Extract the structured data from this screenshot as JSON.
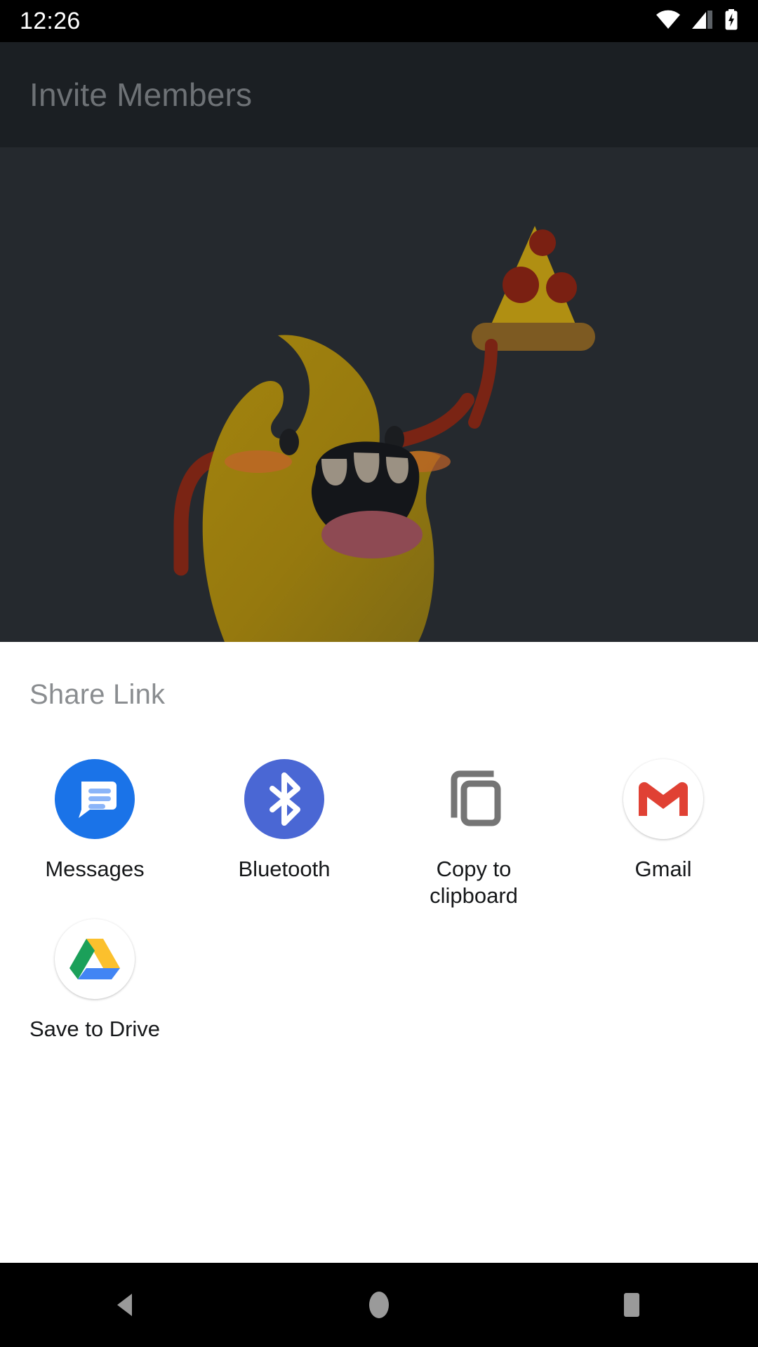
{
  "status_bar": {
    "time": "12:26",
    "icons": [
      {
        "name": "wifi-icon",
        "label": "Wi-Fi signal full"
      },
      {
        "name": "cellular-signal-icon",
        "label": "Mobile signal partial"
      },
      {
        "name": "battery-charging-icon",
        "label": "Battery charging"
      }
    ]
  },
  "app_bar": {
    "title": "Invite Members"
  },
  "content": {
    "illustration": {
      "name": "monster-eating-pizza-illustration",
      "body_color": "#96790e",
      "eye_color": "#1b1d20",
      "cheek_color": "#c2642a",
      "mouth_color": "#14161a",
      "tooth_color": "#9b9183",
      "tongue_color": "#8e4a53",
      "arm_color": "#7a2414",
      "pizza_cheese_color": "#b08f12",
      "pizza_pepperoni_color": "#7a2012",
      "pizza_crust_color": "#7d5a22",
      "background_color": "#25292e"
    }
  },
  "share_sheet": {
    "title": "Share Link",
    "targets": [
      {
        "label": "Messages",
        "icon": "messages-icon",
        "color": "#1a73e8"
      },
      {
        "label": "Bluetooth",
        "icon": "bluetooth-icon",
        "color": "#4a67d4"
      },
      {
        "label": "Copy to clipboard",
        "icon": "copy-to-clipboard-icon",
        "color": "#757575"
      },
      {
        "label": "Gmail",
        "icon": "gmail-icon",
        "color": "#e04134"
      },
      {
        "label": "Save to Drive",
        "icon": "google-drive-icon",
        "color": "#0f9d58"
      }
    ]
  },
  "nav_bar": {
    "buttons": [
      {
        "name": "back-button",
        "label": "Back"
      },
      {
        "name": "home-button",
        "label": "Home"
      },
      {
        "name": "recents-button",
        "label": "Recent apps"
      }
    ],
    "icon_color": "#9a9a9a"
  }
}
